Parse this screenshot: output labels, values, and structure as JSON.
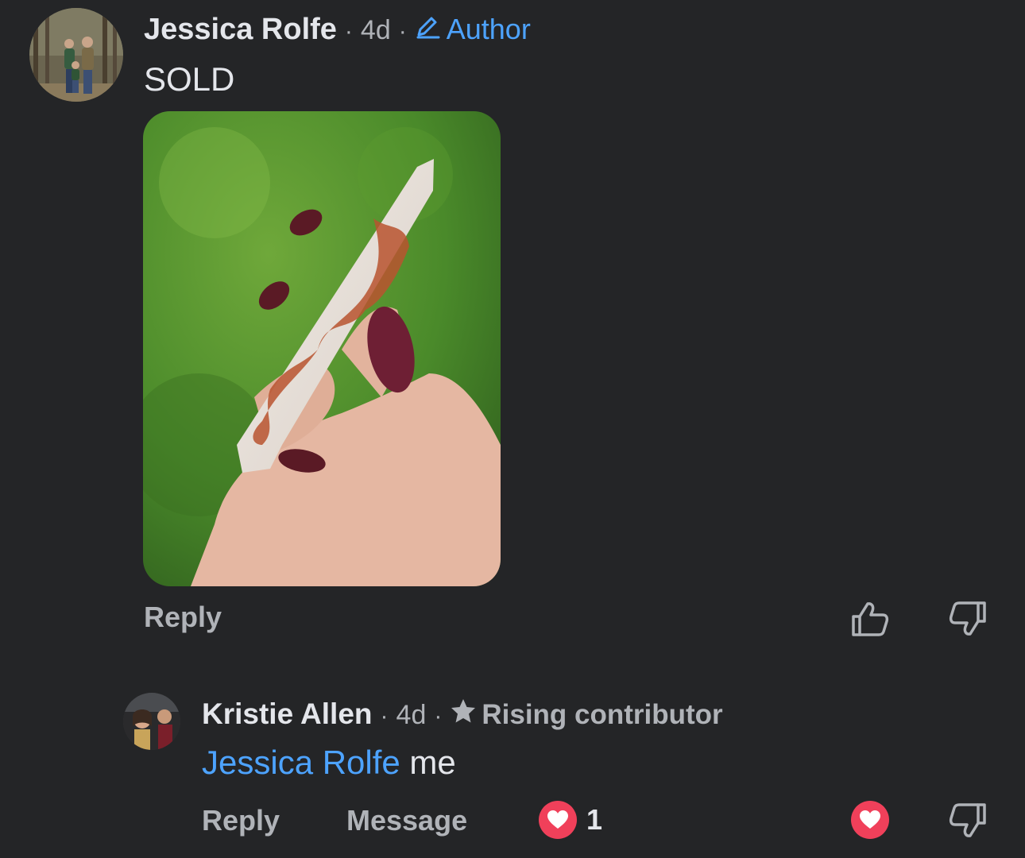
{
  "comments": [
    {
      "author": "Jessica Rolfe",
      "time": "4d",
      "badge": "Author",
      "text": "SOLD",
      "actions": {
        "reply": "Reply"
      }
    },
    {
      "author": "Kristie Allen",
      "time": "4d",
      "badge": "Rising contributor",
      "mention": "Jessica Rolfe",
      "text": " me",
      "actions": {
        "reply": "Reply",
        "message": "Message"
      },
      "reaction_count": "1"
    }
  ],
  "separator": "·",
  "colors": {
    "background": "#242527",
    "link": "#4da3ff",
    "heart": "#f0405a",
    "muted": "#b0b3b8"
  }
}
